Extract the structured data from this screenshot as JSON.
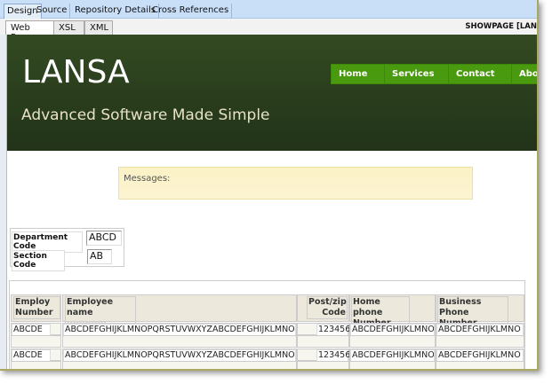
{
  "top_tabs": [
    "Design",
    "Source",
    "Repository Details",
    "Cross References"
  ],
  "sub_tabs": [
    "Web Page",
    "XSL",
    "XML"
  ],
  "page_name": "SHOWPAGE [LAN",
  "banner": {
    "logo": "LANSA",
    "tagline": "Advanced Software Made Simple",
    "nav": [
      "Home",
      "Services",
      "Contact",
      "Abou"
    ]
  },
  "messages_label": "Messages:",
  "form": {
    "dept_label": "Department Code",
    "dept_value": "ABCD",
    "section_label": "Section Code",
    "section_value": "AB"
  },
  "table": {
    "headers": [
      "Employ Number",
      "Employee name",
      "Post/zip Code",
      "Home phone Number",
      "Business Phone Number"
    ],
    "name_underline": "-------------",
    "rows": [
      [
        "ABCDE",
        "ABCDEFGHIJKLMNOPQRSTUVWXYZABCDEFGHIJKLMNO",
        "123456",
        "ABCDEFGHIJKLMNO",
        "ABCDEFGHIJKLMNO"
      ],
      [
        "ABCDE",
        "ABCDEFGHIJKLMNOPQRSTUVWXYZABCDEFGHIJKLMNO",
        "123456",
        "ABCDEFGHIJKLMNO",
        "ABCDEFGHIJKLMNO"
      ]
    ]
  }
}
